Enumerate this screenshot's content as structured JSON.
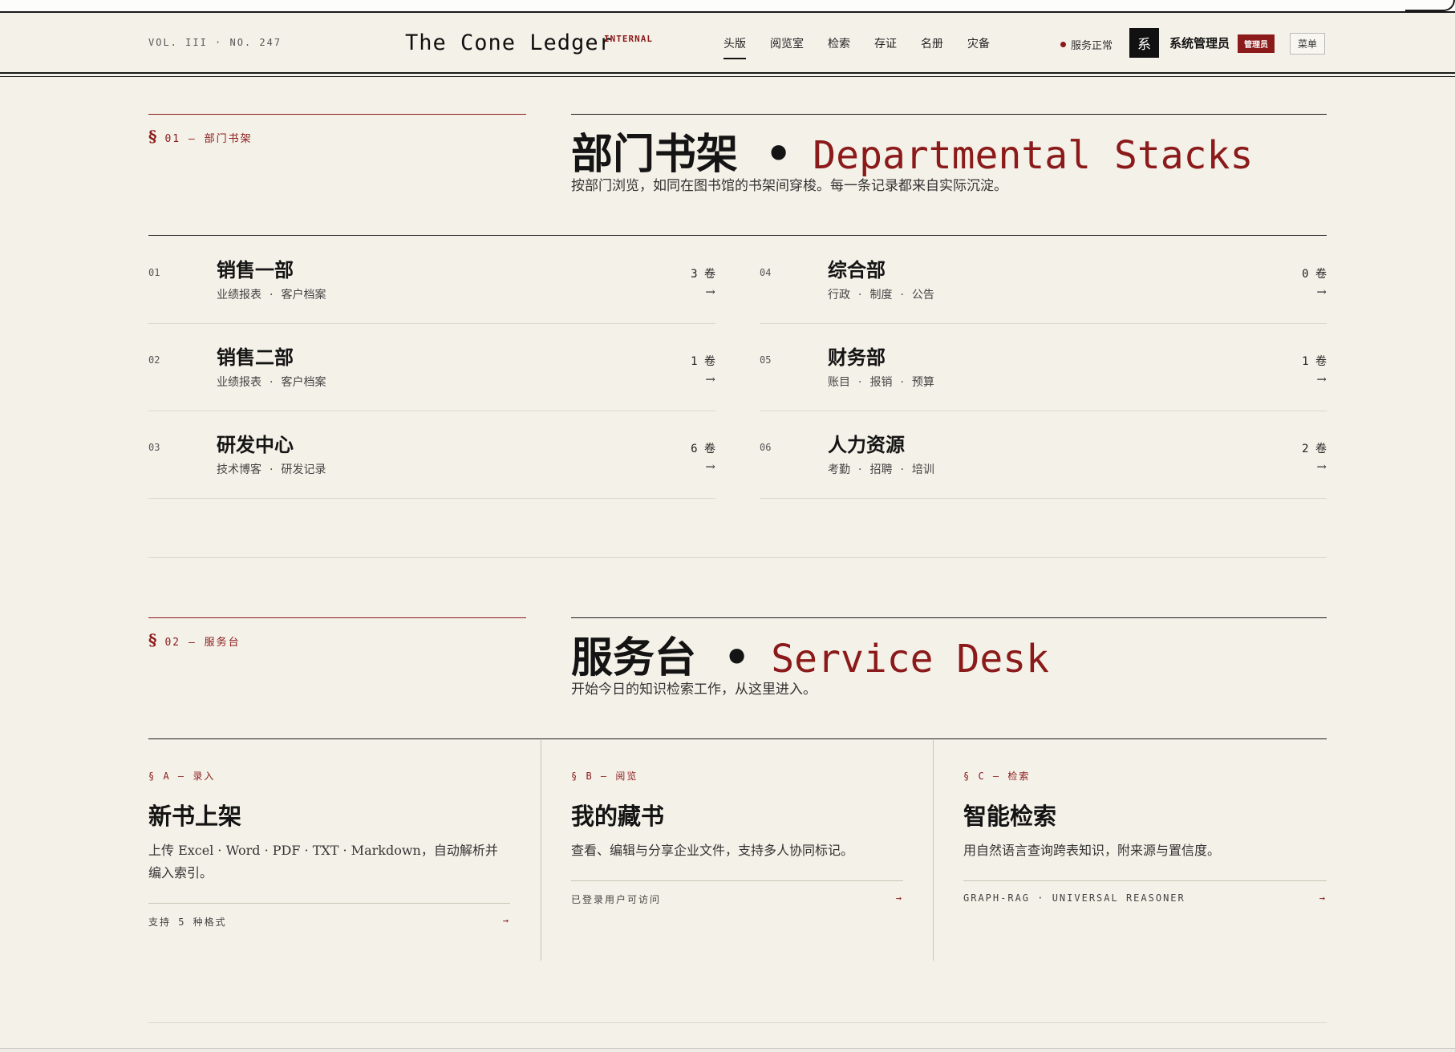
{
  "header": {
    "volume": "VOL. III · NO. 247",
    "brand": "The Cone Ledger",
    "badge": "INTERNAL",
    "nav": [
      "头版",
      "阅览室",
      "检索",
      "存证",
      "名册",
      "灾备"
    ],
    "active_nav": "头版",
    "status": "服务正常",
    "avatar_char": "系",
    "user": "系统管理员",
    "role": "管理员",
    "menu": "菜单"
  },
  "stacks": {
    "label_num": "01",
    "label_text": "部门书架",
    "title_cn": "部门书架",
    "title_en": "Departmental Stacks",
    "subtitle": "按部门浏览，如同在图书馆的书架间穿梭。每一条记录都来自实际沉淀。",
    "departments": [
      {
        "num": "01",
        "name": "销售一部",
        "tags": [
          "业绩报表",
          "客户档案"
        ],
        "count": "3 卷"
      },
      {
        "num": "02",
        "name": "销售二部",
        "tags": [
          "业绩报表",
          "客户档案"
        ],
        "count": "1 卷"
      },
      {
        "num": "03",
        "name": "研发中心",
        "tags": [
          "技术博客",
          "研发记录"
        ],
        "count": "6 卷"
      },
      {
        "num": "04",
        "name": "综合部",
        "tags": [
          "行政",
          "制度",
          "公告"
        ],
        "count": "0 卷"
      },
      {
        "num": "05",
        "name": "财务部",
        "tags": [
          "账目",
          "报销",
          "预算"
        ],
        "count": "1 卷"
      },
      {
        "num": "06",
        "name": "人力资源",
        "tags": [
          "考勤",
          "招聘",
          "培训"
        ],
        "count": "2 卷"
      }
    ]
  },
  "desk": {
    "label_num": "02",
    "label_text": "服务台",
    "title_cn": "服务台",
    "title_en": "Service Desk",
    "subtitle": "开始今日的知识检索工作，从这里进入。",
    "cards": [
      {
        "label": "§ A — 录入",
        "title": "新书上架",
        "desc": "上传 Excel · Word · PDF · TXT · Markdown，自动解析并编入索引。",
        "foot": "支持 5 种格式"
      },
      {
        "label": "§ B — 阅览",
        "title": "我的藏书",
        "desc": "查看、编辑与分享企业文件，支持多人协同标记。",
        "foot": "已登录用户可访问"
      },
      {
        "label": "§ C — 检索",
        "title": "智能检索",
        "desc": "用自然语言查询跨表知识，附来源与置信度。",
        "foot": "GRAPH-RAG · UNIVERSAL REASONER"
      }
    ]
  },
  "colors": {
    "accent": "#8b1a1a",
    "paper": "#f4f1e8",
    "ink": "#141414"
  },
  "icons": {
    "arrow": "arrow-right-icon",
    "status": "status-dot-icon",
    "section": "section-sign-icon"
  }
}
